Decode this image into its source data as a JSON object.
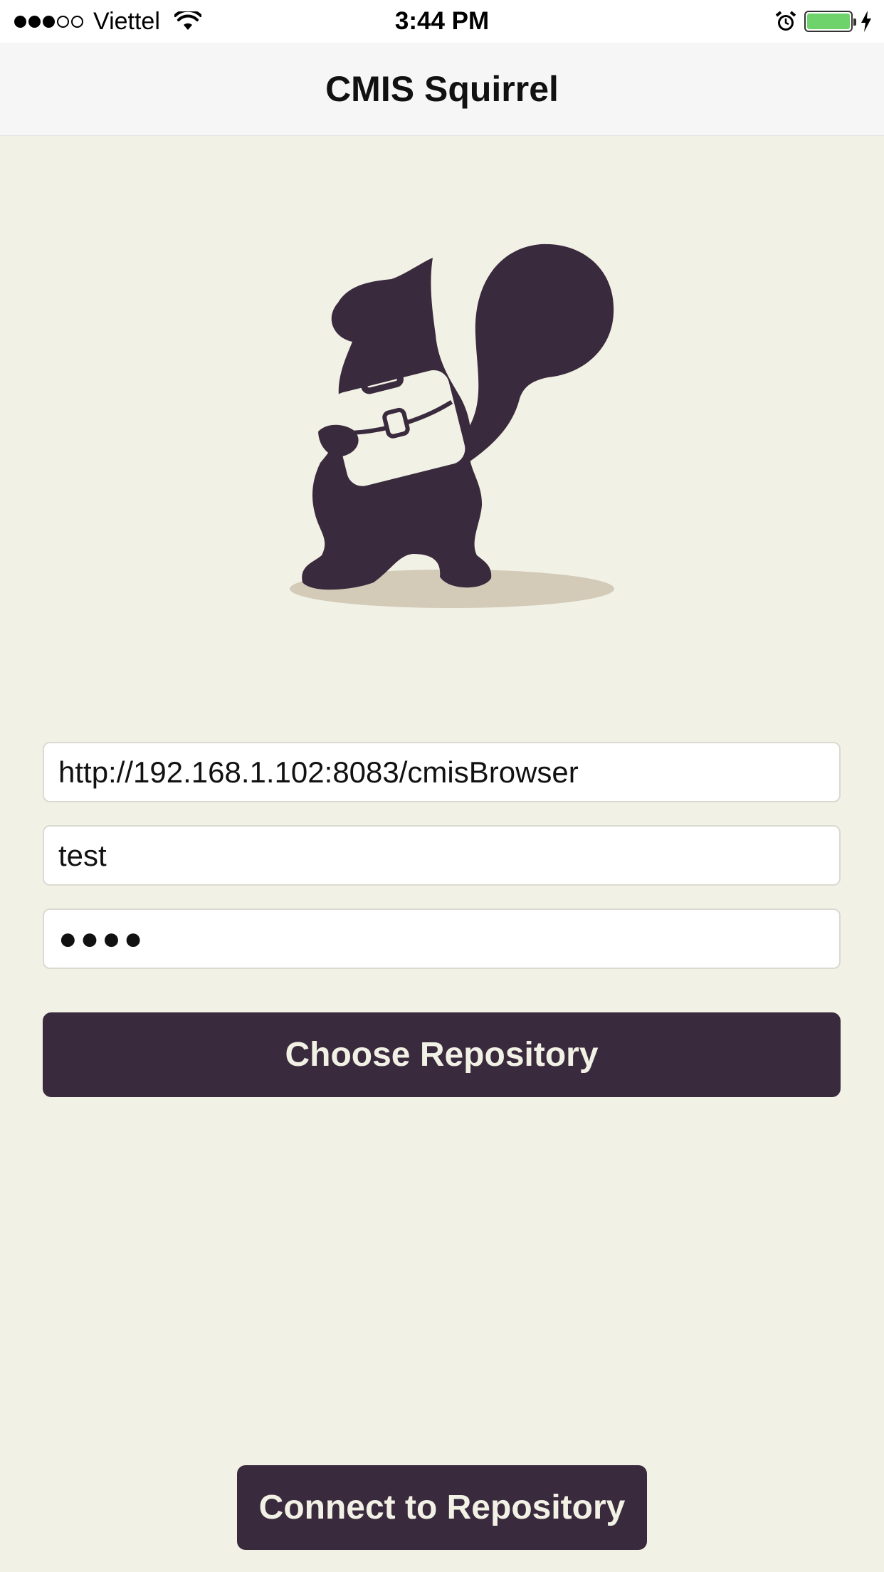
{
  "status_bar": {
    "signal_filled": 3,
    "signal_total": 5,
    "carrier": "Viettel",
    "time": "3:44 PM",
    "battery_level": 1.0,
    "battery_color": "#6fd36b",
    "icons": [
      "wifi-icon",
      "alarm-icon",
      "battery-icon",
      "charging-bolt-icon"
    ]
  },
  "nav": {
    "title": "CMIS Squirrel"
  },
  "logo": {
    "icon": "squirrel-with-briefcase-logo",
    "body_color": "#3a2a3d",
    "shadow_color": "#d3cab8",
    "briefcase_color": "#f2f1e5"
  },
  "form": {
    "url_value": "http://192.168.1.102:8083/cmisBrowser",
    "username_value": "test",
    "password_masked": "●●●●"
  },
  "buttons": {
    "choose_repository": "Choose Repository",
    "connect_repository": "Connect to Repository"
  },
  "colors": {
    "background": "#f2f1e5",
    "primary": "#3a2a3d",
    "nav_background": "#f6f6f6"
  }
}
